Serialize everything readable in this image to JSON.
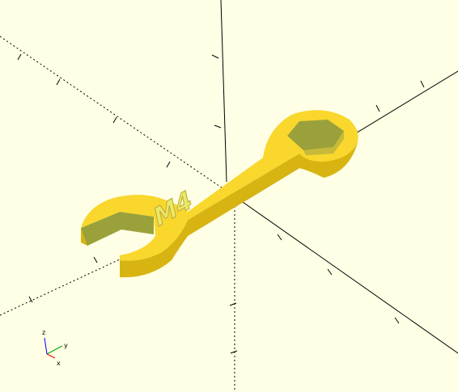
{
  "viewport": {
    "background": "#ffffe5"
  },
  "model": {
    "engraved_text": "M4",
    "top_color": "#f9d72c",
    "side_color": "#d8b413",
    "inner_wall_color": "#9aa13a",
    "engraving_color": "#d4d05a"
  },
  "axes_gizmo": {
    "x_label": "x",
    "y_label": "y",
    "z_label": "z",
    "x_color": "#ff0000",
    "y_color": "#00a000",
    "z_color": "#0000ff"
  }
}
